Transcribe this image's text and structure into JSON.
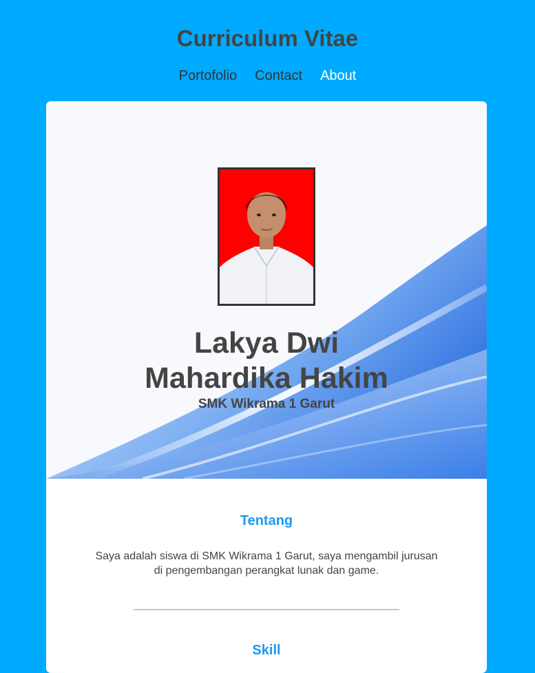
{
  "header": {
    "title": "Curriculum Vitae",
    "nav": [
      {
        "label": "Portofolio",
        "active": false
      },
      {
        "label": "Contact",
        "active": false
      },
      {
        "label": "About",
        "active": true
      }
    ]
  },
  "profile": {
    "name_line1": "Lakya Dwi",
    "name_line2": "Mahardika Hakim",
    "school": "SMK Wikrama 1 Garut"
  },
  "sections": {
    "about": {
      "title": "Tentang",
      "text": "Saya adalah siswa di SMK Wikrama 1 Garut, saya mengambil jurusan di pengembangan perangkat lunak dan game."
    },
    "skill": {
      "title": "Skill"
    }
  },
  "colors": {
    "page_background": "#00aaff",
    "heading_text": "#444444",
    "nav_text": "#333333",
    "nav_active": "#ffffff",
    "section_title": "#1a9bf0",
    "photo_background": "#ff0000"
  }
}
